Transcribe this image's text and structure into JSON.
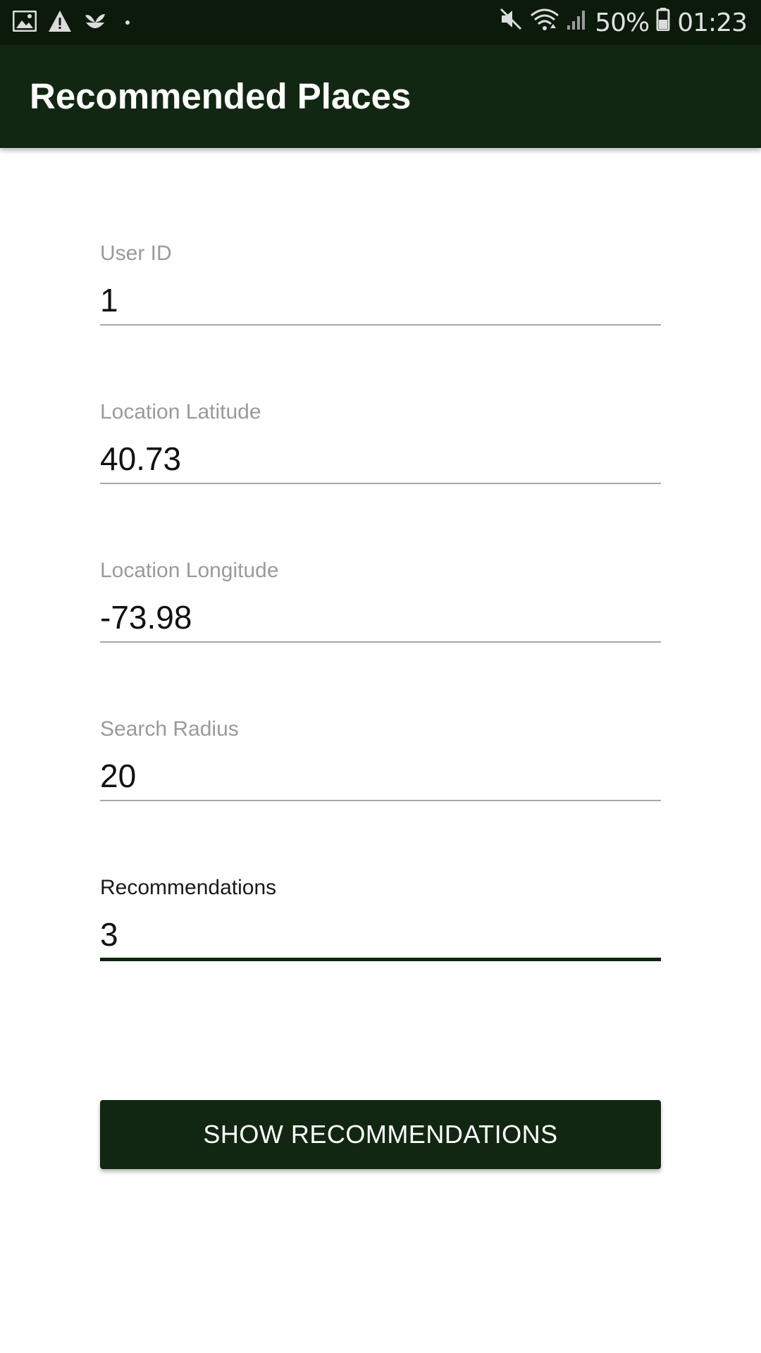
{
  "status_bar": {
    "left_icons": [
      "gallery-icon",
      "warning-icon",
      "plant-icon",
      "dot-icon"
    ],
    "right_icons": [
      "mute-icon",
      "wifi-icon",
      "signal-icon",
      "battery-icon"
    ],
    "battery_percent": "50%",
    "time": "01:23"
  },
  "app_bar": {
    "title": "Recommended Places"
  },
  "form": {
    "user_id": {
      "label": "User ID",
      "value": "1"
    },
    "latitude": {
      "label": "Location Latitude",
      "value": "40.73"
    },
    "longitude": {
      "label": "Location Longitude",
      "value": "-73.98"
    },
    "radius": {
      "label": "Search Radius",
      "value": "20"
    },
    "recommendations": {
      "label": "Recommendations",
      "value": "3",
      "focused": true
    }
  },
  "actions": {
    "show_recommendations_label": "SHOW RECOMMENDATIONS"
  },
  "colors": {
    "status_bar_bg": "#0b1a0b",
    "app_bar_bg": "#122712",
    "primary": "#122712",
    "label_inactive": "#9a9a9a",
    "underline_inactive": "#a7a7a7"
  }
}
